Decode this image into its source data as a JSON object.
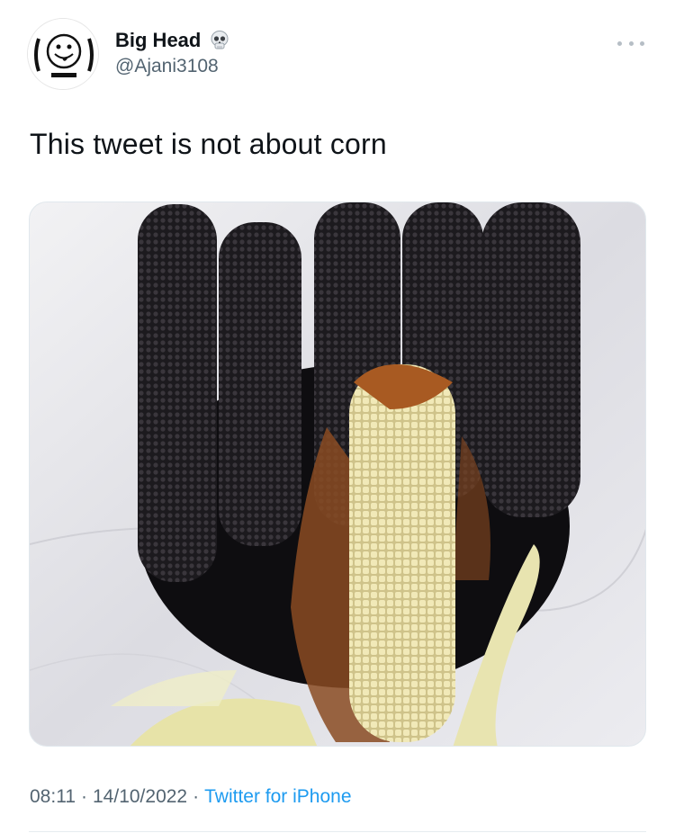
{
  "author": {
    "display_name": "Big Head",
    "handle": "@Ajani3108",
    "badge_icon": "skull-emoji-icon",
    "avatar_icon": "smiley-tongue-face-icon"
  },
  "tweet": {
    "text": "This tweet is not about corn",
    "media_description_icon": "corn-photo"
  },
  "meta": {
    "time": "08:11",
    "separator": "·",
    "date": "14/10/2022",
    "source": "Twitter for iPhone"
  },
  "colors": {
    "text": "#0f1419",
    "secondary": "#536471",
    "link": "#1d9bf0"
  }
}
